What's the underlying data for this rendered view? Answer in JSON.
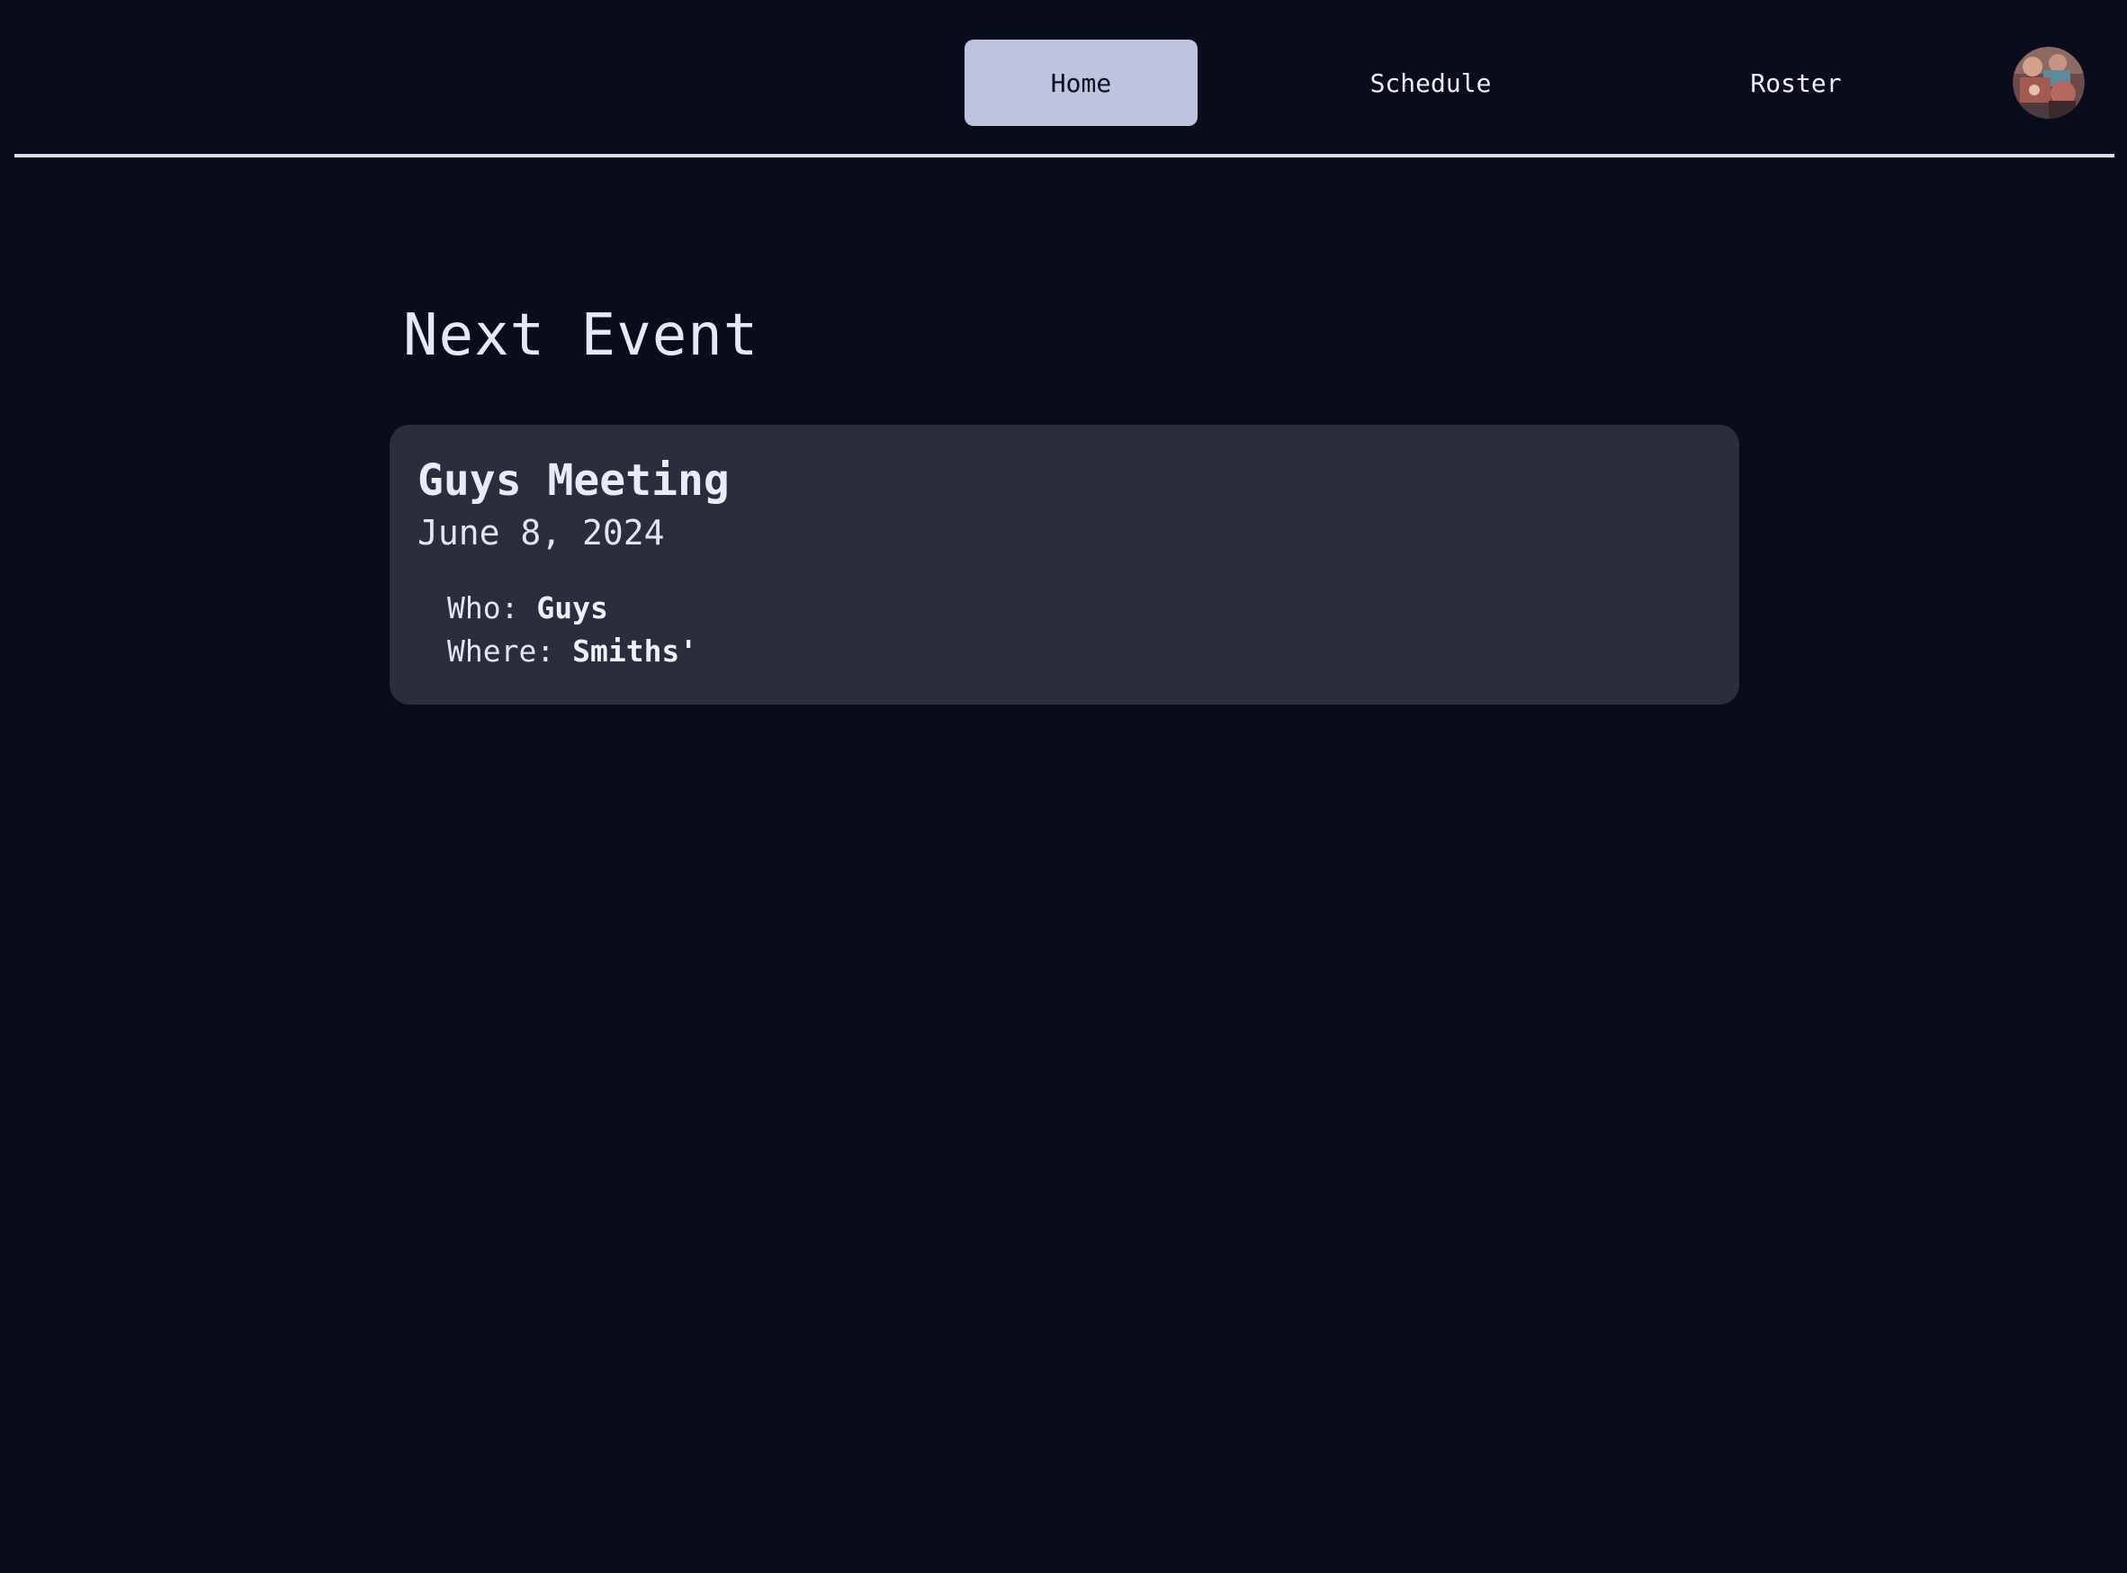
{
  "nav": {
    "items": [
      {
        "label": "Home",
        "active": true
      },
      {
        "label": "Schedule",
        "active": false
      },
      {
        "label": "Roster",
        "active": false
      }
    ],
    "active_color": "#bcc4de"
  },
  "avatar": {
    "icon": "user-avatar-photo"
  },
  "main": {
    "heading": "Next Event",
    "event": {
      "title": "Guys Meeting",
      "date": "June 8, 2024",
      "who_label": "Who:",
      "who_value": "Guys",
      "where_label": "Where:",
      "where_value": "Smiths'"
    }
  },
  "colors": {
    "background": "#090c1b",
    "card": "#2b2d3c",
    "text": "#e6e8f5"
  }
}
